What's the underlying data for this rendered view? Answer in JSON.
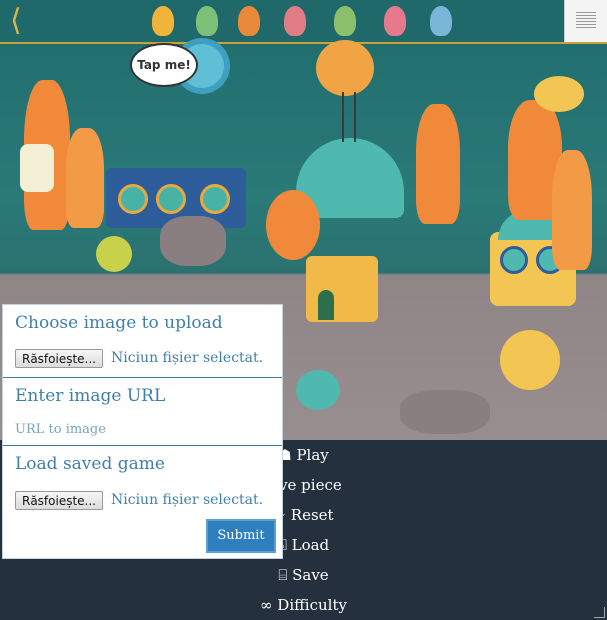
{
  "scene": {
    "bubble_text": "Tap me!",
    "back_icon": "chevron-left-icon",
    "menu_icon": "hamburger-menu-icon"
  },
  "controls": [
    {
      "label": "☗ Play",
      "icon": "play-icon"
    },
    {
      "label": "olve piece",
      "icon": "puzzle-icon"
    },
    {
      "label": "⟳ Reset",
      "icon": "reset-icon"
    },
    {
      "label": "⌻ Load",
      "icon": "load-icon"
    },
    {
      "label": "⌸ Save",
      "icon": "save-icon"
    },
    {
      "label": "∞ Difficulty",
      "icon": "infinity-icon"
    }
  ],
  "panel": {
    "upload_title": "Choose image to upload",
    "browse_label": "Răsfoiește...",
    "no_file": "Niciun fișier selectat.",
    "url_title": "Enter image URL",
    "url_placeholder": "URL to image",
    "load_title": "Load saved game",
    "browse_label_2": "Răsfoiește...",
    "no_file_2": "Niciun fișier selectat.",
    "submit_label": "Submit"
  }
}
